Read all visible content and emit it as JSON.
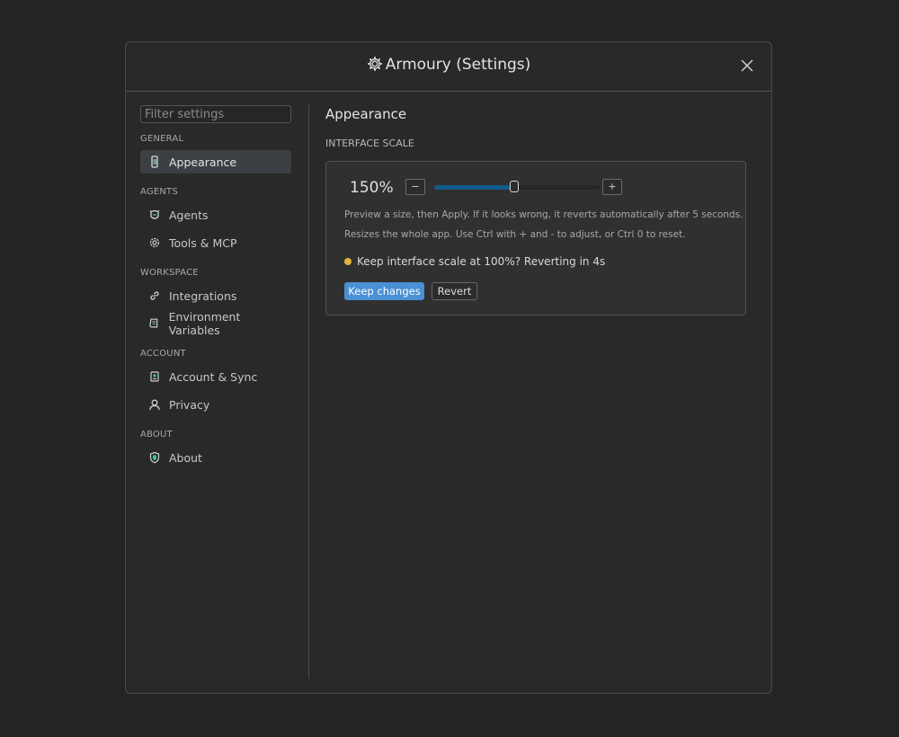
{
  "window": {
    "title": "Armoury (Settings)"
  },
  "sidebar": {
    "filter_placeholder": "Filter settings",
    "sections": [
      {
        "label": "GENERAL",
        "items": [
          {
            "label": "Appearance",
            "icon": "brush-icon",
            "active": true
          }
        ]
      },
      {
        "label": "AGENTS",
        "items": [
          {
            "label": "Agents",
            "icon": "agent-helmet-icon"
          },
          {
            "label": "Tools & MCP",
            "icon": "cog-tools-icon"
          }
        ]
      },
      {
        "label": "WORKSPACE",
        "items": [
          {
            "label": "Integrations",
            "icon": "link-icon"
          },
          {
            "label": "Environment Variables",
            "icon": "scroll-icon"
          }
        ]
      },
      {
        "label": "ACCOUNT",
        "items": [
          {
            "label": "Account & Sync",
            "icon": "account-sync-icon"
          },
          {
            "label": "Privacy",
            "icon": "person-icon"
          }
        ]
      },
      {
        "label": "ABOUT",
        "items": [
          {
            "label": "About",
            "icon": "shield-icon"
          }
        ]
      }
    ]
  },
  "main": {
    "title": "Appearance",
    "section_title": "INTERFACE SCALE",
    "scale": {
      "value_label": "150%",
      "decrease_label": "−",
      "increase_label": "+",
      "slider_fraction": 0.48,
      "hint_1": "Preview a size, then Apply. If it looks wrong, it reverts automatically after 5 seconds.",
      "hint_2": "Resizes the whole app. Use Ctrl with + and - to adjust, or Ctrl 0 to reset.",
      "status_text": "Keep interface scale at 100%? Reverting in 4s",
      "keep_label": "Keep changes",
      "revert_label": "Revert"
    }
  },
  "colors": {
    "accent": "#4a90d4",
    "slider_fill": "#0f5b8a",
    "status_dot": "#e6b43c",
    "icon_accent": "#3ec7a0"
  }
}
